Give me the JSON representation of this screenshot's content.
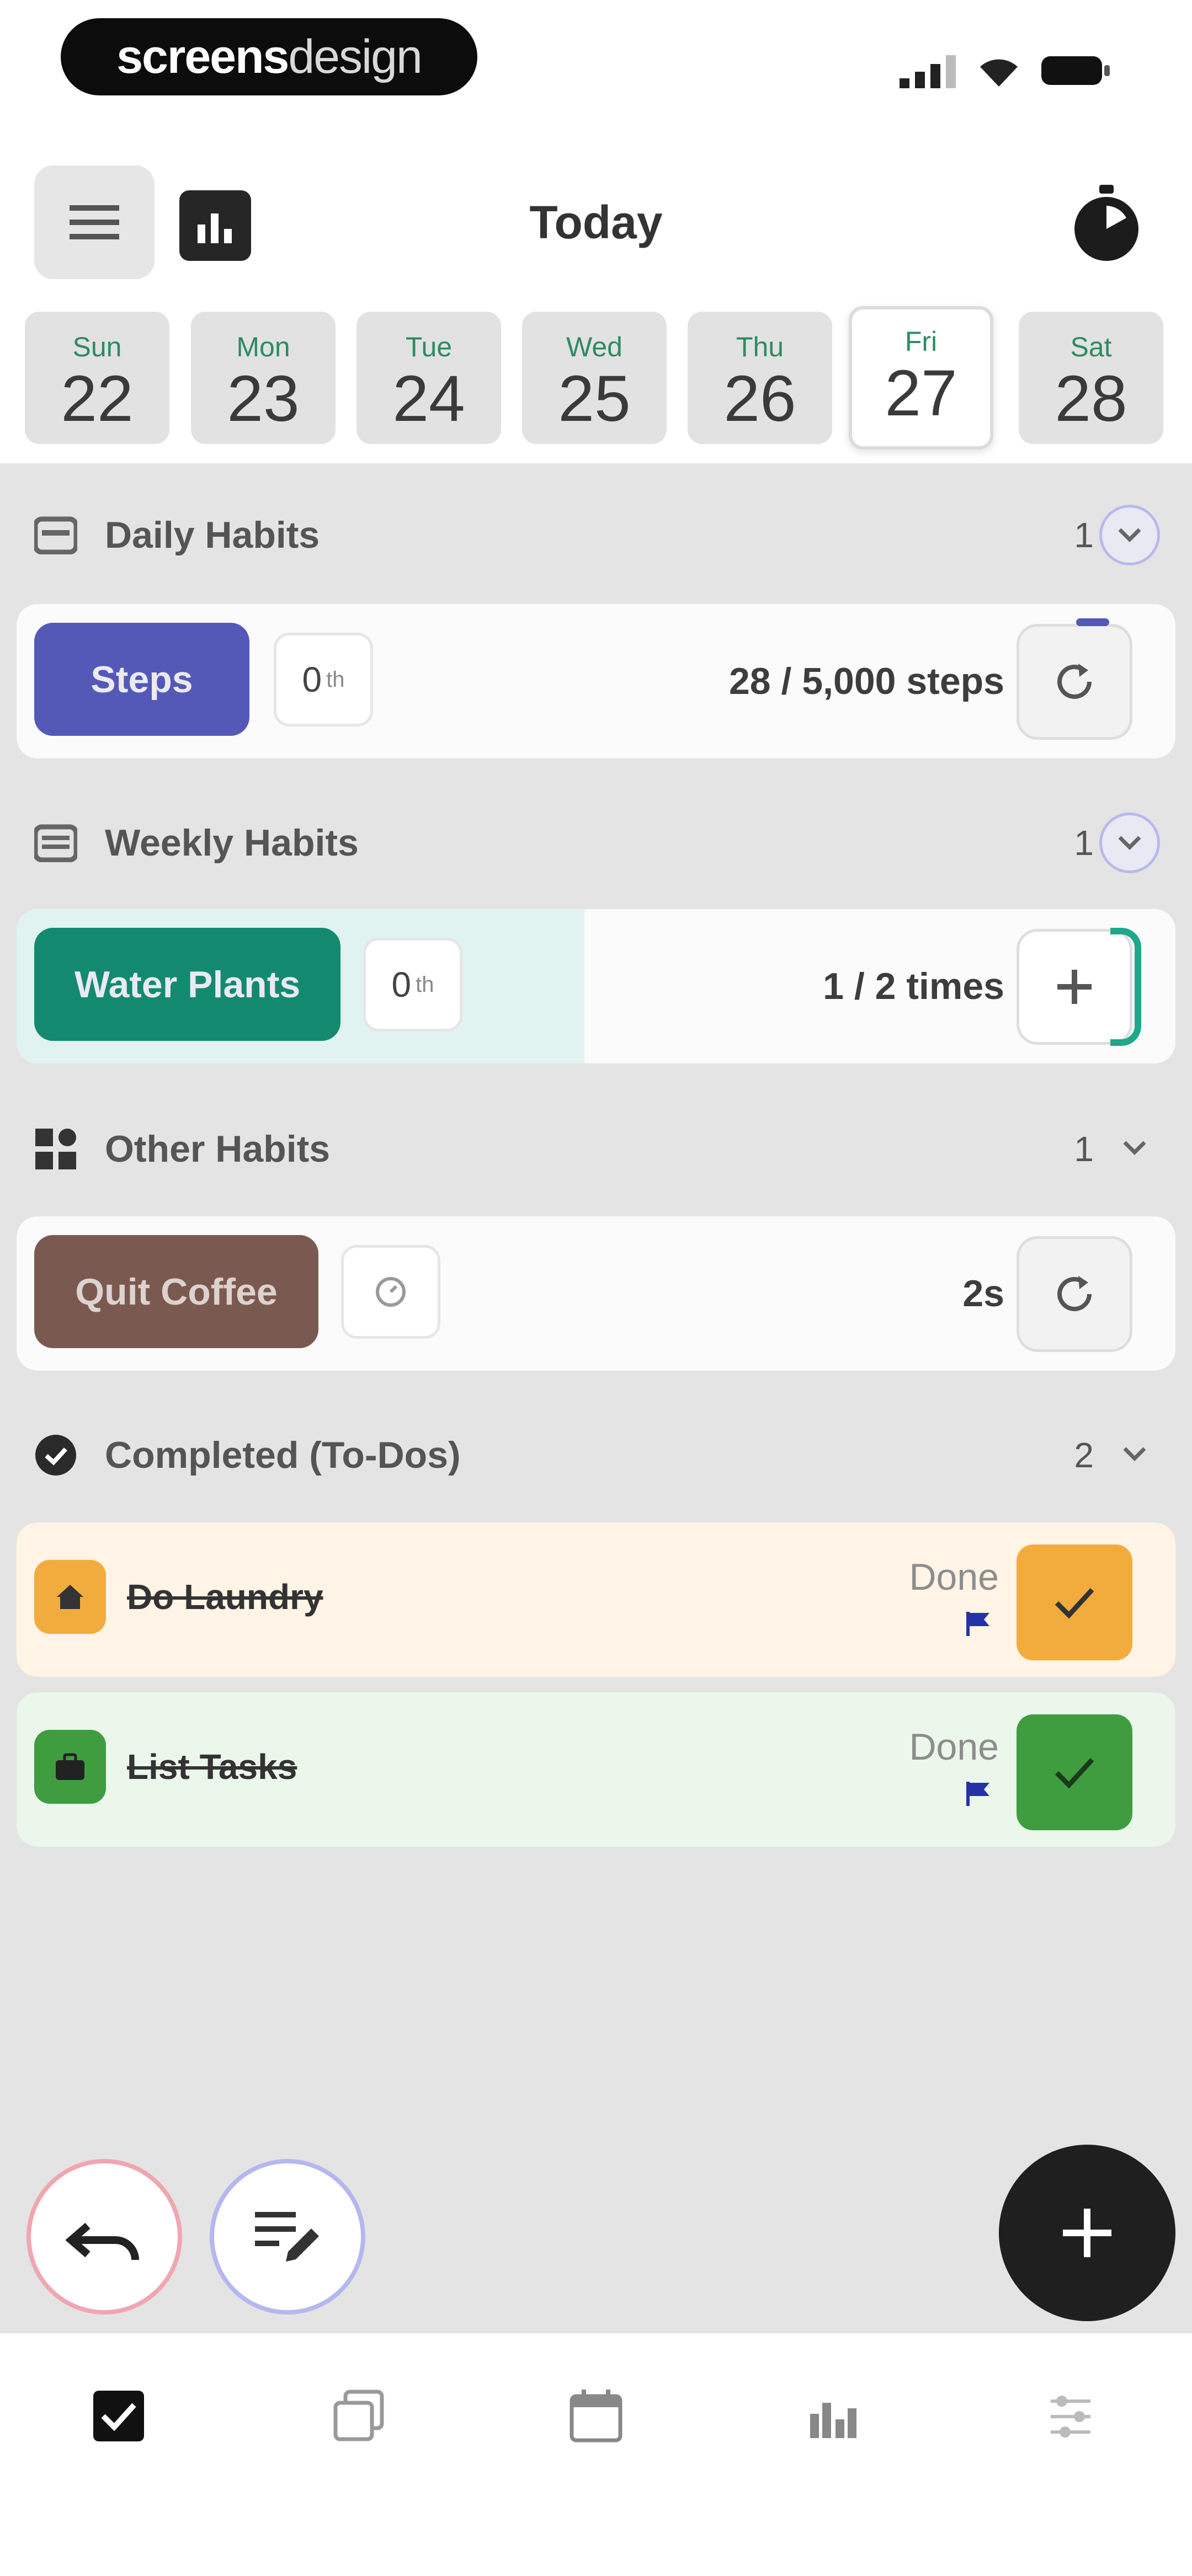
{
  "status_bar": {
    "logo_main": "screens",
    "logo_thin": "design"
  },
  "header": {
    "title": "Today"
  },
  "week": [
    {
      "name": "Sun",
      "date": "22"
    },
    {
      "name": "Mon",
      "date": "23"
    },
    {
      "name": "Tue",
      "date": "24"
    },
    {
      "name": "Wed",
      "date": "25"
    },
    {
      "name": "Thu",
      "date": "26"
    },
    {
      "name": "Fri",
      "date": "27",
      "selected": true
    },
    {
      "name": "Sat",
      "date": "28"
    }
  ],
  "sections": {
    "daily": {
      "title": "Daily Habits",
      "count": "1",
      "habit": {
        "label": "Steps",
        "streak": "0",
        "progress": "28 / 5,000 steps",
        "color": "#5459b8"
      }
    },
    "weekly": {
      "title": "Weekly Habits",
      "count": "1",
      "habit": {
        "label": "Water Plants",
        "streak": "0",
        "progress": "1 / 2 times",
        "color": "#138a6f",
        "fill_fraction": 0.5
      }
    },
    "other": {
      "title": "Other Habits",
      "count": "1",
      "habit": {
        "label": "Quit Coffee",
        "progress": "2s",
        "color": "#7a5a50"
      }
    },
    "completed": {
      "title": "Completed (To-Dos)",
      "count": "2",
      "todos": [
        {
          "title": "Do Laundry",
          "status": "Done",
          "color": "#f2ac3e",
          "bg": "#fff4e6"
        },
        {
          "title": "List Tasks",
          "status": "Done",
          "color": "#3f9d3f",
          "bg": "#eaf7ea"
        }
      ]
    }
  },
  "tabs": [
    "Today",
    "Habits",
    "Calendar",
    "Stats",
    "Settings"
  ]
}
